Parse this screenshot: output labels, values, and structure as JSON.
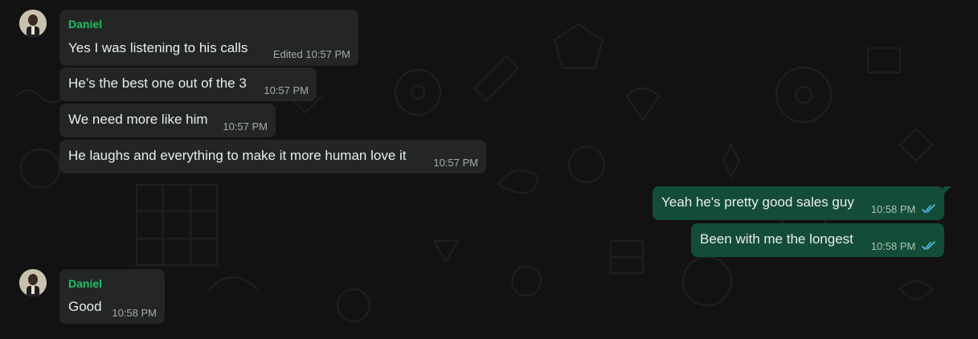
{
  "colors": {
    "background": "#111211",
    "incoming_bubble": "#242626",
    "outgoing_bubble": "#144d37",
    "sender_name": "#21c063",
    "read_ticks": "#53bdeb"
  },
  "messages": [
    {
      "direction": "incoming",
      "sender": "Daniel",
      "text": "Yes I was listening to his calls",
      "edited_label": "Edited",
      "time": "10:57 PM"
    },
    {
      "direction": "incoming",
      "text": "He’s the best one out of the 3",
      "time": "10:57 PM"
    },
    {
      "direction": "incoming",
      "text": "We need more like him",
      "time": "10:57 PM"
    },
    {
      "direction": "incoming",
      "text": "He laughs and everything to make it more human love it",
      "time": "10:57 PM"
    },
    {
      "direction": "outgoing",
      "text": "Yeah he's pretty good sales guy",
      "time": "10:58 PM",
      "status_icon": "double-check-read-icon"
    },
    {
      "direction": "outgoing",
      "text": "Been with me the longest",
      "time": "10:58 PM",
      "status_icon": "double-check-read-icon"
    },
    {
      "direction": "incoming",
      "sender": "Daniel",
      "text": "Good",
      "time": "10:58 PM"
    }
  ]
}
